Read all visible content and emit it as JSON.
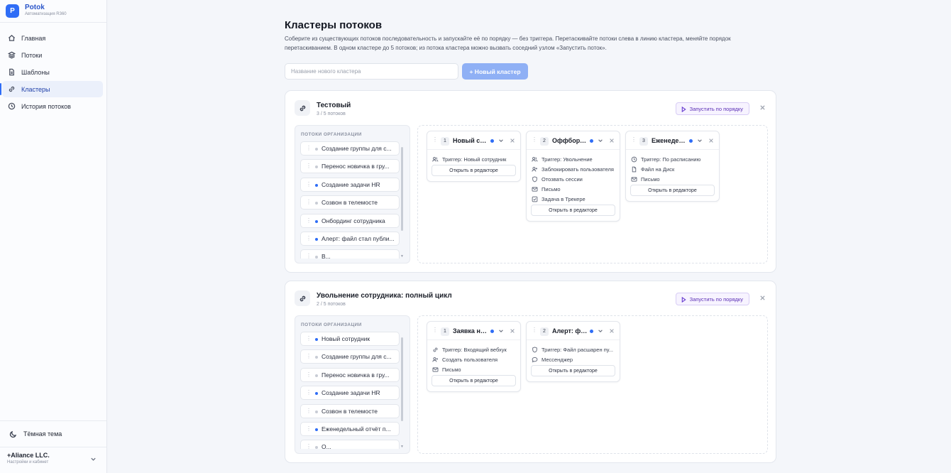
{
  "app": {
    "name": "Potok",
    "subtitle": "Автоматизация R360"
  },
  "sidebar": {
    "items": [
      {
        "label": "Главная",
        "icon": "home-icon"
      },
      {
        "label": "Потоки",
        "icon": "layers-icon"
      },
      {
        "label": "Шаблоны",
        "icon": "document-icon"
      },
      {
        "label": "Кластеры",
        "icon": "link-icon",
        "active": true
      },
      {
        "label": "История потоков",
        "icon": "clock-icon"
      }
    ],
    "theme_label": "Тёмная тема",
    "account": {
      "name": "+Aliance LLC.",
      "sub": "Настройки и кабинет"
    }
  },
  "page": {
    "title": "Кластеры потоков",
    "description": "Соберите из существующих потоков последовательность и запускайте её по порядку — без триггера. Перетаскивайте потоки слева в линию кластера, меняйте порядок перетаскиванием. В одном кластере до 5 потоков; из потока кластера можно вызвать соседний узлом «Запустить поток».",
    "new_cluster_placeholder": "Название нового кластера",
    "new_cluster_button": "+ Новый кластер"
  },
  "labels": {
    "org_flows_title": "ПОТОКИ ОРГАНИЗАЦИИ",
    "run_button": "Запустить по порядку",
    "open_editor": "Открыть в редакторе"
  },
  "clusters": [
    {
      "title": "Тестовый",
      "count": "3 / 5 потоков",
      "org_flows": [
        {
          "label": "Создание группы для с...",
          "active": false
        },
        {
          "label": "Перенос новичка в гру...",
          "active": false
        },
        {
          "label": "Создание задачи HR",
          "active": true
        },
        {
          "label": "Созвон в телемосте",
          "active": false
        },
        {
          "label": "Онбординг сотрудника",
          "active": true
        },
        {
          "label": "Алерт: файл стал публи...",
          "active": true
        },
        {
          "label": "В...",
          "active": false
        }
      ],
      "cards": [
        {
          "num": "1",
          "name": "Новый со...",
          "steps": [
            {
              "icon": "users-icon",
              "text": "Триггер: Новый сотрудник"
            }
          ]
        },
        {
          "num": "2",
          "name": "Оффборд...",
          "steps": [
            {
              "icon": "users-icon",
              "text": "Триггер: Увольнение"
            },
            {
              "icon": "user-plus-icon",
              "text": "Заблокировать пользователя"
            },
            {
              "icon": "shield-icon",
              "text": "Отозвать сессии"
            },
            {
              "icon": "mail-icon",
              "text": "Письмо"
            },
            {
              "icon": "checkbox-icon",
              "text": "Задача в Трекере"
            }
          ]
        },
        {
          "num": "3",
          "name": "Еженедел...",
          "steps": [
            {
              "icon": "clock-icon",
              "text": "Триггер: По расписанию"
            },
            {
              "icon": "file-icon",
              "text": "Файл на Диск"
            },
            {
              "icon": "mail-icon",
              "text": "Письмо"
            }
          ]
        }
      ]
    },
    {
      "title": "Увольнение сотрудника: полный цикл",
      "count": "2 / 5 потоков",
      "org_flows": [
        {
          "label": "Новый сотрудник",
          "active": true
        },
        {
          "label": "Создание группы для с...",
          "active": false
        },
        {
          "label": "Перенос новичка в гру...",
          "active": false
        },
        {
          "label": "Создание задачи HR",
          "active": true
        },
        {
          "label": "Созвон в телемосте",
          "active": false
        },
        {
          "label": "Еженедельный отчёт п...",
          "active": true
        },
        {
          "label": "О...",
          "active": false
        }
      ],
      "cards": [
        {
          "num": "1",
          "name": "Заявка на...",
          "steps": [
            {
              "icon": "link-icon",
              "text": "Триггер: Входящий вебхук"
            },
            {
              "icon": "user-plus-icon",
              "text": "Создать пользователя"
            },
            {
              "icon": "mail-icon",
              "text": "Письмо"
            }
          ]
        },
        {
          "num": "2",
          "name": "Алерт: фа...",
          "steps": [
            {
              "icon": "shield-icon",
              "text": "Триггер: Файл расшарен пу..."
            },
            {
              "icon": "chat-icon",
              "text": "Мессенджер"
            }
          ]
        }
      ]
    }
  ]
}
